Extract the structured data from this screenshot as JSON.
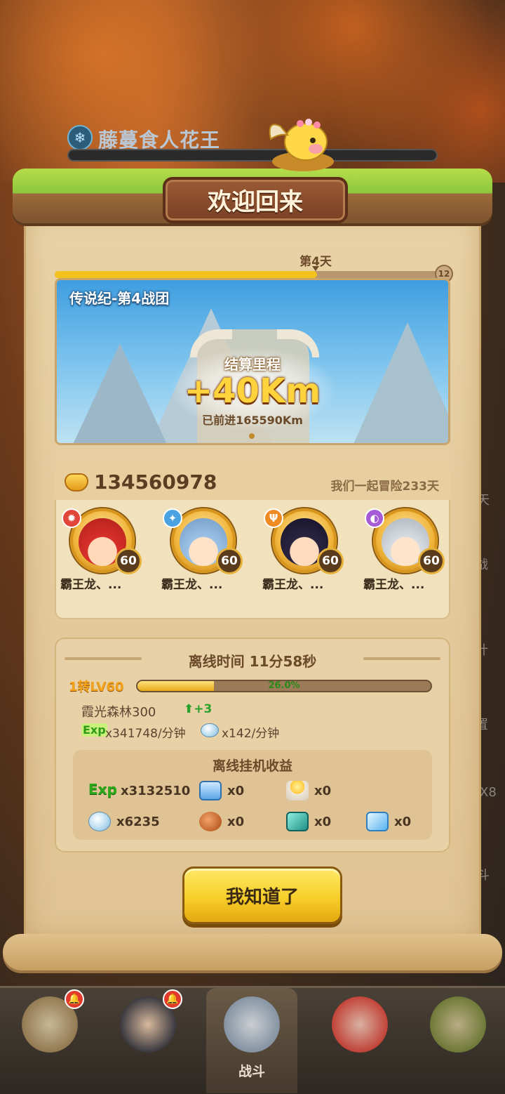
{
  "background": {
    "boss_name": "藤蔓食人花王",
    "side_labels": [
      "天",
      "战",
      "计",
      "置",
      "X8",
      "斗"
    ]
  },
  "dialog": {
    "title": "欢迎回来",
    "day_label": "第4天",
    "day_progress": 0.68,
    "day_total": "12",
    "team_name": "传说纪-第4战团",
    "distance_label": "结算里程",
    "distance_value": "+40Km",
    "distance_total": "已前进165590Km"
  },
  "team": {
    "gold": "134560978",
    "adventure_days": "我们一起冒险233天",
    "heroes": [
      {
        "name": "霸王龙、...",
        "level": "60",
        "element": "fire-icon",
        "color": "#e2463a",
        "hair": "#d8302a"
      },
      {
        "name": "霸王龙、...",
        "level": "60",
        "element": "wind-icon",
        "color": "#4aa3e0",
        "hair": "#9cc2e6"
      },
      {
        "name": "霸王龙、...",
        "level": "60",
        "element": "trident-icon",
        "color": "#f08a22",
        "hair": "#2a2440"
      },
      {
        "name": "霸王龙、...",
        "level": "60",
        "element": "dark-icon",
        "color": "#a65bd6",
        "hair": "#d8dde2"
      }
    ]
  },
  "offline": {
    "title": "离线时间 11分58秒",
    "level_label": "1转LV60",
    "exp_percent_text": "26.0%",
    "exp_fraction": 0.26,
    "stage": "霞光森林300",
    "stage_up": "+3",
    "exp_rate_icon": "Exp",
    "exp_rate": "x341748/分钟",
    "stone_rate": "x142/分钟",
    "gains_title": "离线挂机收益",
    "gains": [
      {
        "icon": "exp-icon",
        "value": "x3132510"
      },
      {
        "icon": "crystal-pack-icon",
        "value": "x0"
      },
      {
        "icon": "candle-icon",
        "value": "x0"
      },
      {
        "icon": "stone-icon",
        "value": "x6235"
      },
      {
        "icon": "meat-icon",
        "value": "x0"
      },
      {
        "icon": "teal-gem-icon",
        "value": "x0"
      },
      {
        "icon": "ice-crystal-icon",
        "value": "x0"
      }
    ],
    "exp_gain_label": "Exp"
  },
  "confirm_label": "我知道了",
  "nav": [
    {
      "label": "",
      "badge": "bell-icon"
    },
    {
      "label": "",
      "badge": "bell-icon"
    },
    {
      "label": "战斗",
      "badge": ""
    },
    {
      "label": "",
      "badge": ""
    },
    {
      "label": "",
      "badge": ""
    }
  ]
}
